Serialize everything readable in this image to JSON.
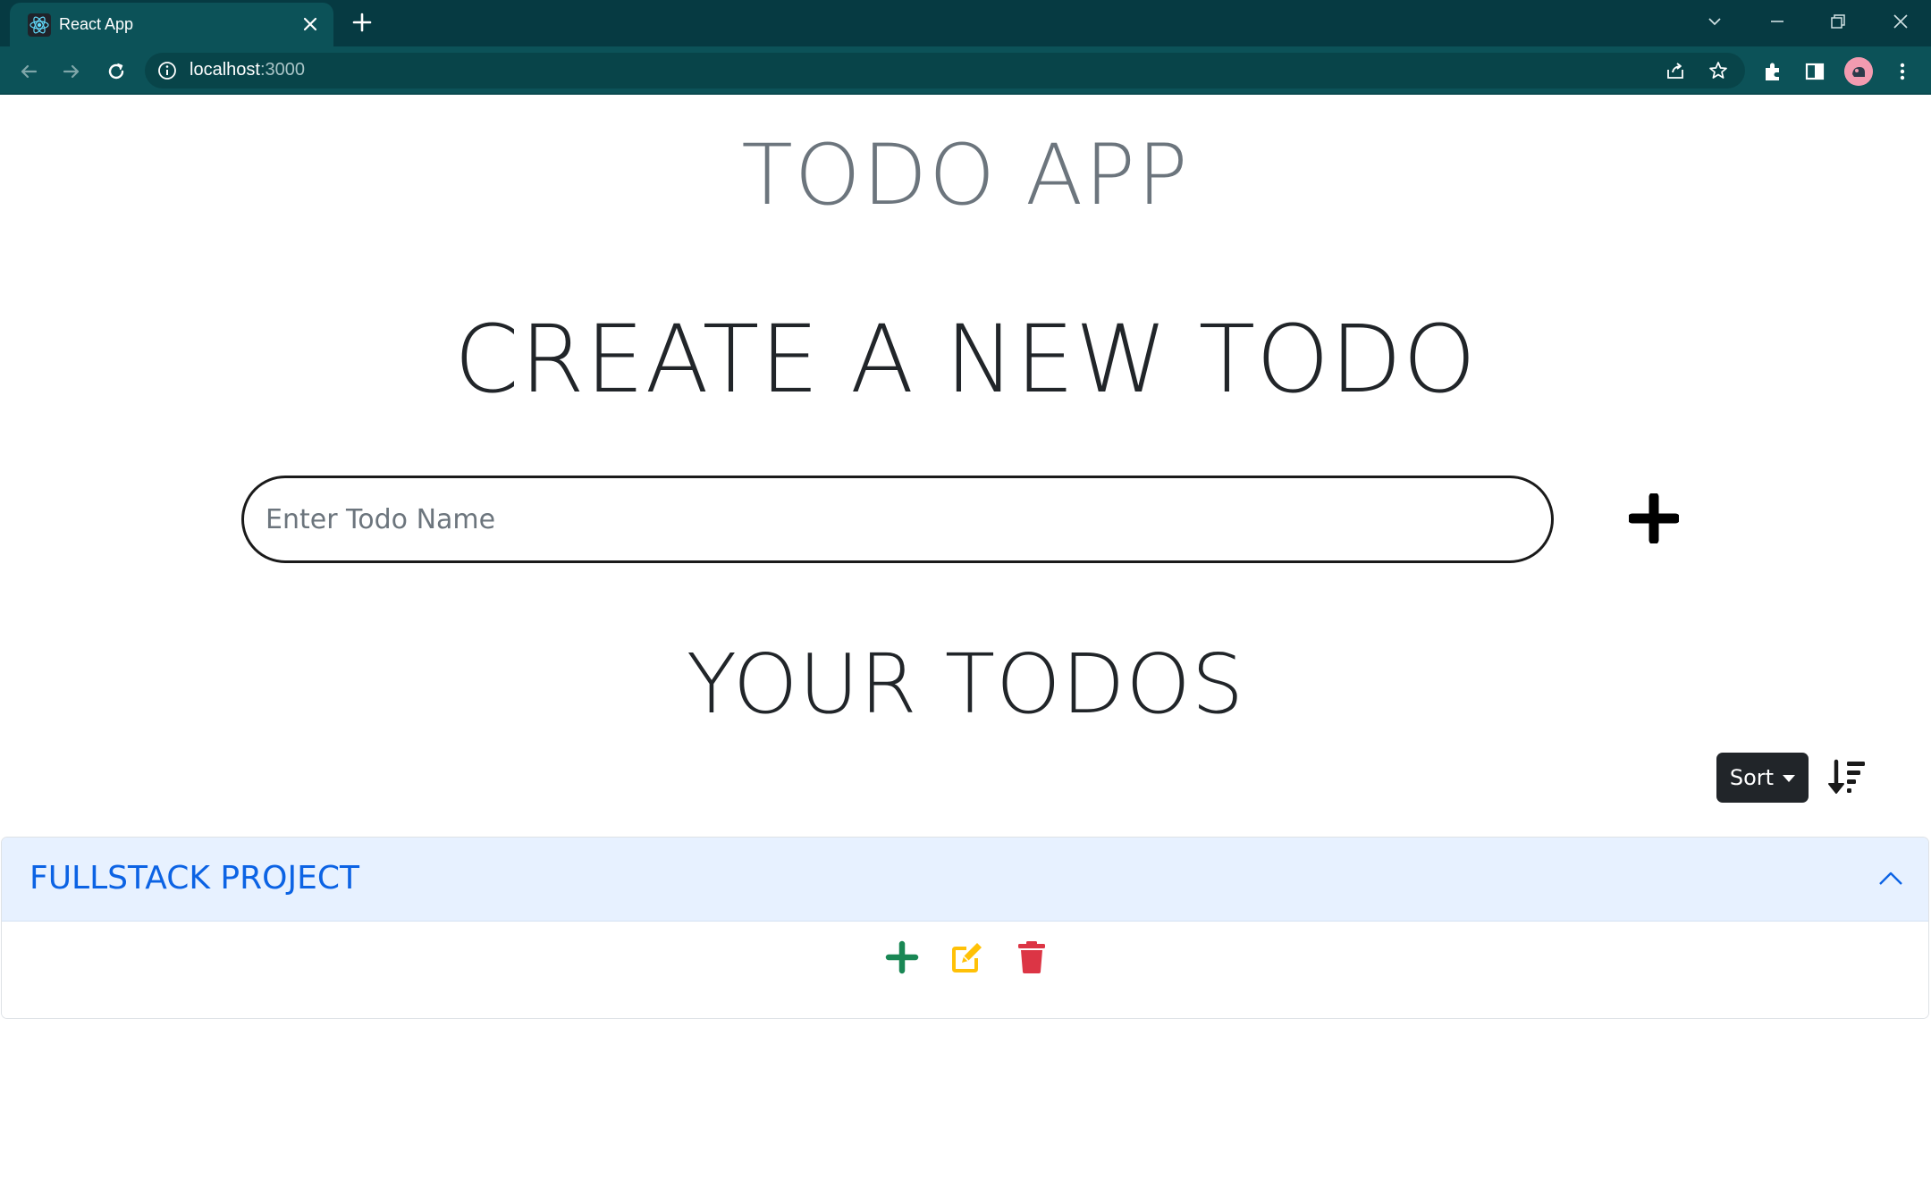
{
  "browser": {
    "tab_title": "React App",
    "url_host": "localhost",
    "url_port": ":3000",
    "icons": [
      "react-icon",
      "close-icon",
      "plus-icon",
      "chevron-down-icon",
      "minimize-icon",
      "restore-icon",
      "close-icon",
      "back-icon",
      "forward-icon",
      "reload-icon",
      "info-icon",
      "share-icon",
      "star-icon",
      "extensions-icon",
      "side-panel-icon",
      "avatar",
      "kebab-menu-icon"
    ]
  },
  "app": {
    "title": "TODO APP",
    "create_heading": "CREATE A NEW TODO",
    "input_placeholder": "Enter Todo Name",
    "input_value": "",
    "your_heading": "YOUR TODOS",
    "sort_label": "Sort"
  },
  "todos": [
    {
      "name": "FULLSTACK PROJECT",
      "expanded": true
    }
  ],
  "colors": {
    "chrome_dark": "#063a42",
    "chrome_toolbar": "#0c5258",
    "title_gray": "#6c757d",
    "heading_dark": "#212529",
    "accordion_header_bg": "#e7f1ff",
    "accordion_title": "#0c63e4",
    "add_green": "#198754",
    "edit_yellow": "#ffc107",
    "delete_red": "#dc3545"
  }
}
